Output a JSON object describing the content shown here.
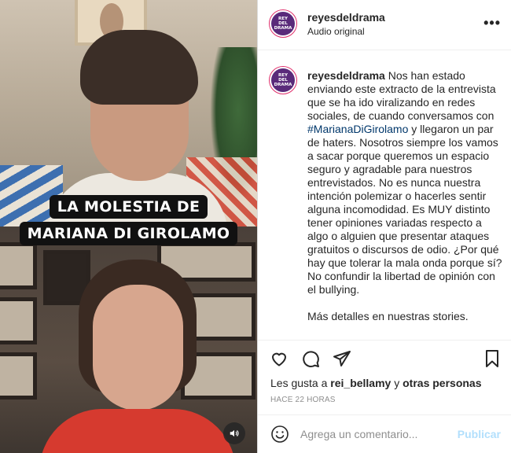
{
  "media": {
    "caption_line1": "LA MOLESTIA DE",
    "caption_line2": "MARIANA DI GIROLAMO",
    "audio_icon": "speaker-icon"
  },
  "header": {
    "username": "reyesdeldrama",
    "subtitle": "Audio original",
    "more_icon": "•••",
    "avatar_text": [
      "REY",
      "DEL",
      "DRAMA"
    ]
  },
  "post_caption": {
    "username": "reyesdeldrama",
    "text_part1": "Nos han estado enviando este extracto de la entrevista que se ha ido viralizando en redes sociales, de cuando conversamos con",
    "hashtag": "#MarianaDiGirolamo",
    "text_part2": "y llegaron un par de haters. Nosotros siempre los vamos a sacar porque queremos un espacio seguro y agradable para nuestros entrevistados. No es nunca nuestra intención polemizar o hacerles sentir alguna incomodidad. Es MUY distinto tener opiniones variadas respecto a algo o alguien que presentar ataques gratuitos o discursos de odio. ¿Por qué hay que tolerar la mala onda porque sí? No confundir la libertad de opinión con el bullying.",
    "text_part3": "Más detalles en nuestras stories."
  },
  "actions": {
    "icons": [
      "heart-icon",
      "comment-icon",
      "share-icon",
      "bookmark-icon"
    ]
  },
  "likes": {
    "prefix": "Les gusta a",
    "user": "rei_bellamy",
    "connector": "y",
    "others": "otras personas"
  },
  "time_ago": "HACE 22 HORAS",
  "comment_box": {
    "placeholder": "Agrega un comentario...",
    "post_label": "Publicar"
  },
  "colors": {
    "link": "#00376b",
    "post_disabled": "#b2dffc",
    "avatar_bg": "#5a2a7a",
    "avatar_ring": "#e1306c"
  }
}
